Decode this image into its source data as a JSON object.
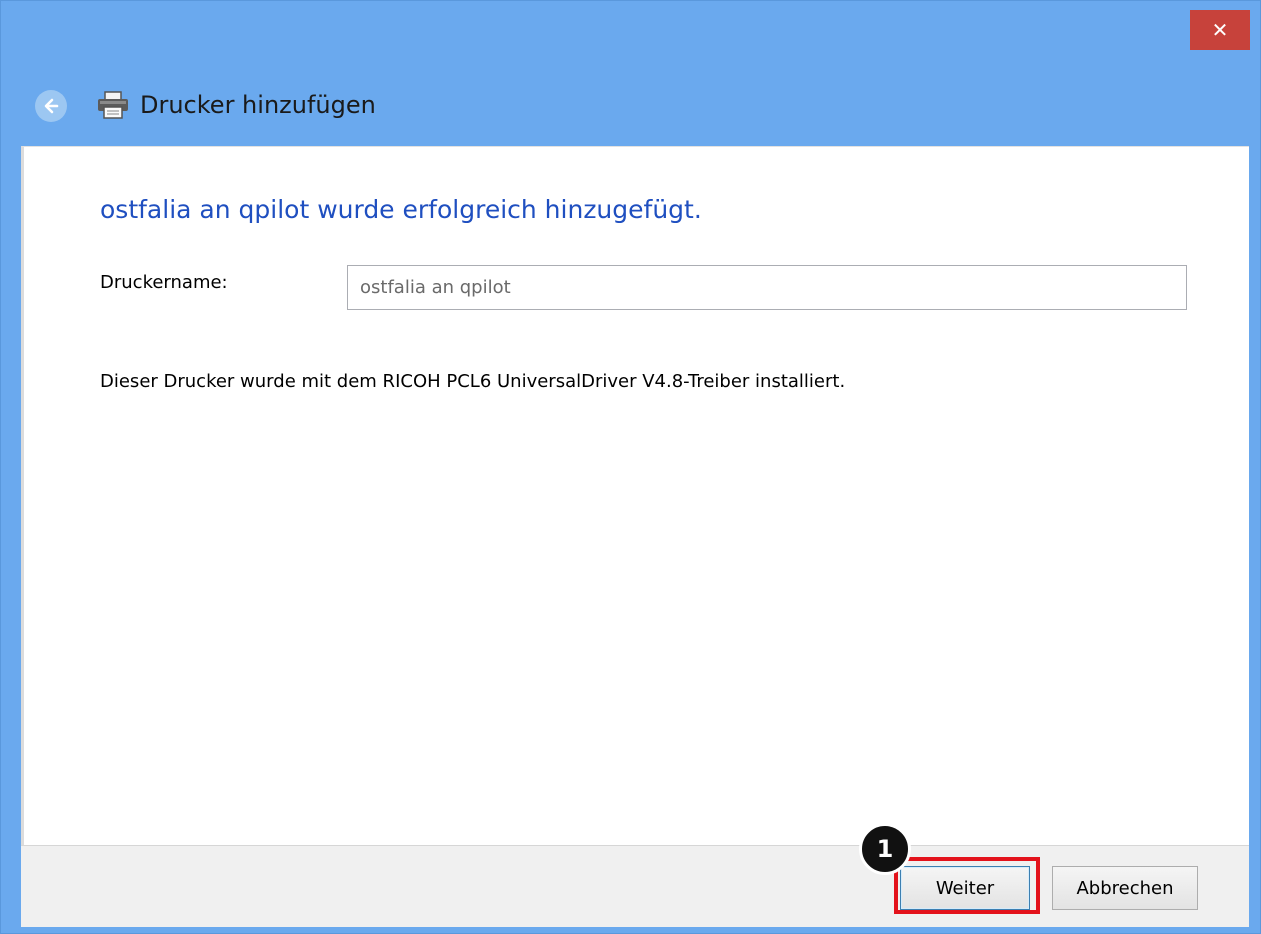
{
  "window": {
    "title": "Drucker hinzufügen",
    "close_glyph": "✕",
    "accent_color": "#6aa9ee",
    "close_color": "#c7423b"
  },
  "icons": {
    "back": "back-arrow-icon",
    "title": "printer-icon",
    "close": "close-icon"
  },
  "main": {
    "heading": "ostfalia an qpilot wurde erfolgreich hinzugefügt.",
    "heading_color": "#1f4fc0",
    "printer_name_label": "Druckername:",
    "printer_name_value": "ostfalia an qpilot",
    "info": "Dieser Drucker wurde mit dem RICOH PCL6 UniversalDriver V4.8-Treiber installiert."
  },
  "footer": {
    "next_label": "Weiter",
    "cancel_label": "Abbrechen"
  },
  "annotation": {
    "step_number": "1",
    "highlight_color": "#e3121b"
  }
}
